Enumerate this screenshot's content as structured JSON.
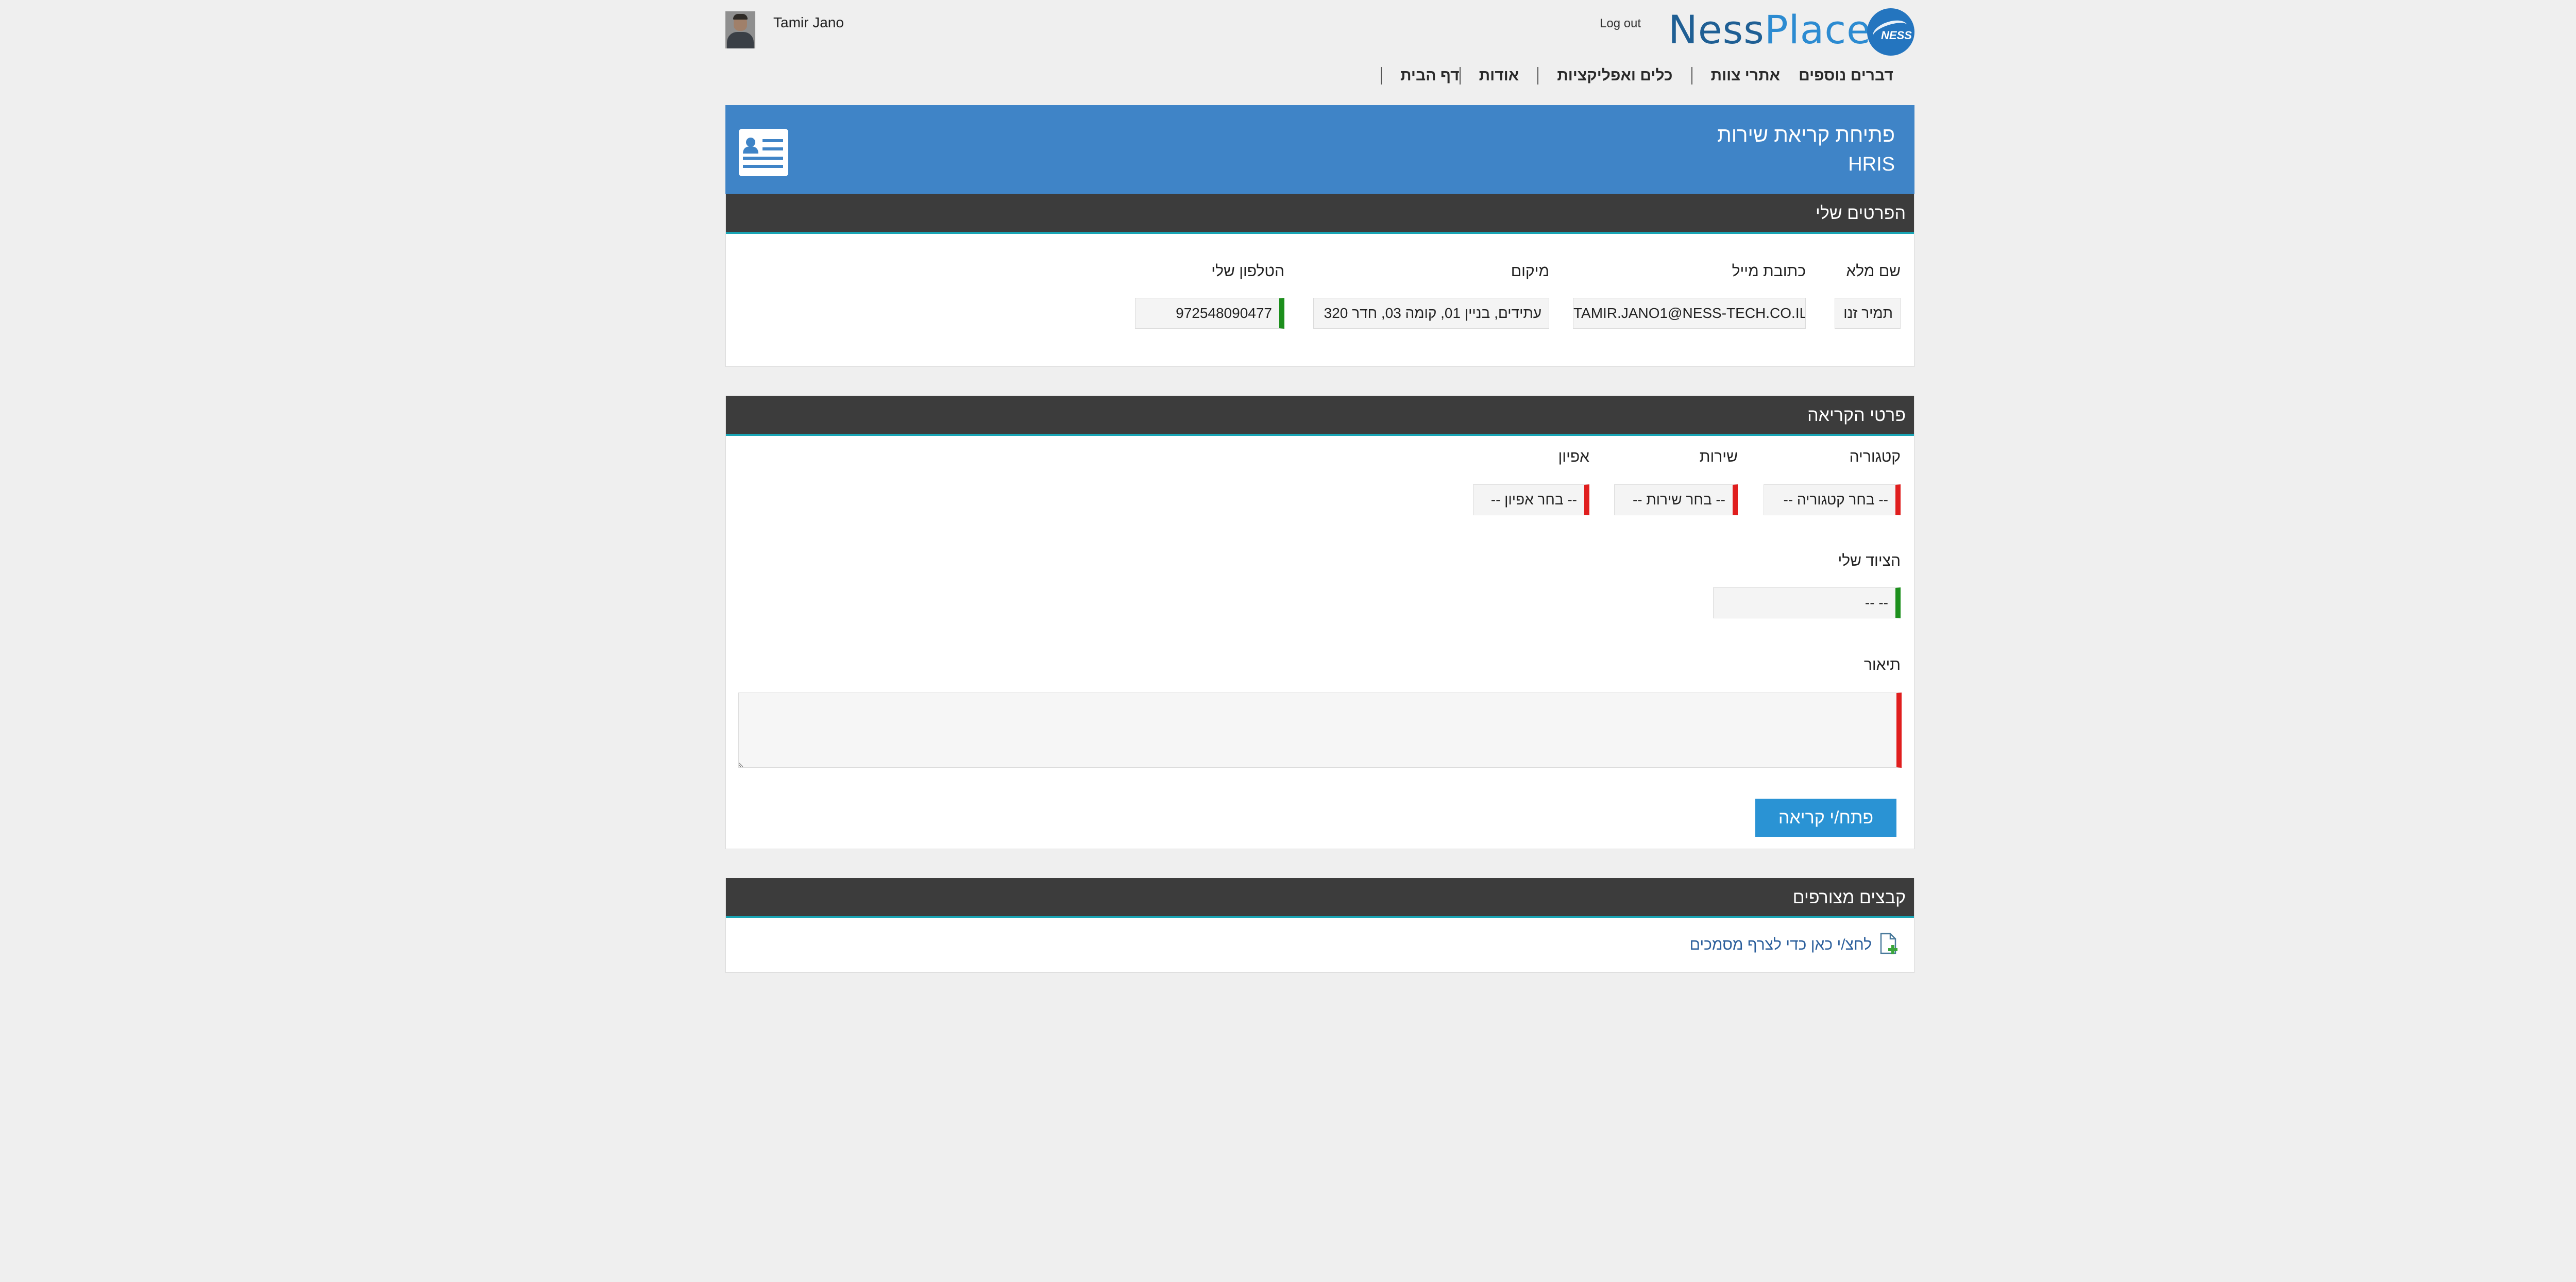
{
  "header": {
    "user_name": "Tamir Jano",
    "logout_label": "Log out",
    "logo_word1": "Ness",
    "logo_word2": "Place",
    "logo_badge": "NESS"
  },
  "nav": {
    "items": [
      {
        "label": "דף הבית"
      },
      {
        "label": "אודות"
      },
      {
        "label": "כלים ואפליקציות"
      },
      {
        "label": "אתרי צוות"
      },
      {
        "label": "דברים נוספים"
      }
    ]
  },
  "banner": {
    "title": "פתיחת קריאת שירות",
    "subtitle": "HRIS"
  },
  "my_details": {
    "heading": "הפרטים שלי",
    "full_name_label": "שם מלא",
    "full_name_value": "תמיר זנו",
    "email_label": "כתובת מייל",
    "email_value": "TAMIR.JANO1@NESS-TECH.CO.IL",
    "location_label": "מיקום",
    "location_value": "עתידים, בניין 01, קומה 03, חדר 320",
    "phone_label": "הטלפון שלי",
    "phone_value": "972548090477"
  },
  "request": {
    "heading": "פרטי הקריאה",
    "category_label": "קטגוריה",
    "category_value": "-- בחר קטגוריה --",
    "service_label": "שירות",
    "service_value": "-- בחר שירות --",
    "feature_label": "אפיון",
    "feature_value": "-- בחר אפיון --",
    "equipment_label": "הציוד שלי",
    "equipment_value": "-- --",
    "description_label": "תיאור",
    "description_value": "",
    "submit_label": "פתח/י קריאה"
  },
  "files": {
    "heading": "קבצים מצורפים",
    "attach_label": "לחצ/י כאן כדי לצרף מסמכים"
  },
  "colors": {
    "banner": "#3f84c7",
    "panel_header": "#3c3c3c",
    "accent_line": "#19a5b5",
    "required": "#e01e1e",
    "valid": "#1c8f1c",
    "button": "#2a93d4"
  }
}
